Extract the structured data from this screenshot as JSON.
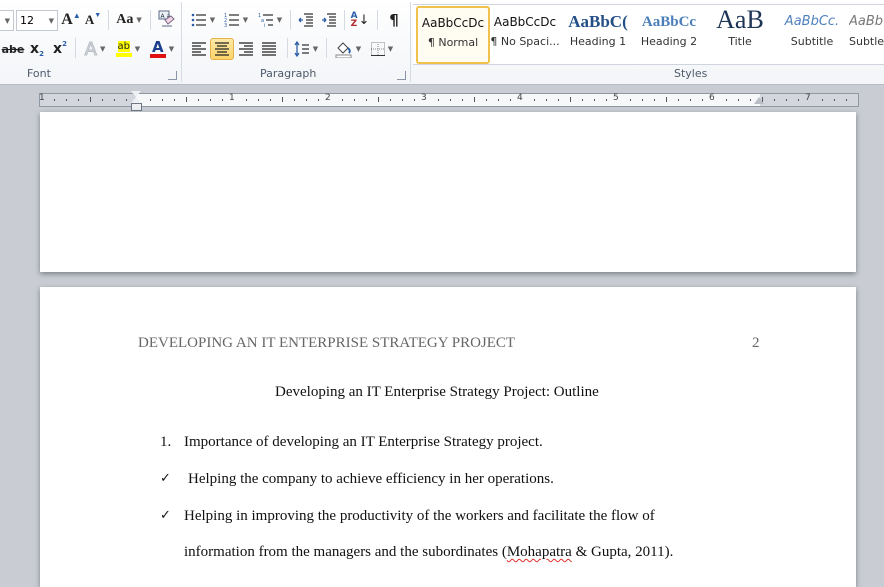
{
  "ribbon": {
    "font_group": {
      "label": "Font",
      "font_size": "12",
      "grow_font": "A",
      "shrink_font": "A",
      "change_case": "Aa",
      "strikethrough": "abe",
      "subscript": "x",
      "superscript": "x",
      "text_effects": "A",
      "highlight": "ab",
      "font_color": "A",
      "highlight_color": "#ffff00",
      "font_color_value": "#e01010"
    },
    "paragraph_group": {
      "label": "Paragraph",
      "pilcrow": "¶",
      "sort_a": "A",
      "sort_z": "Z"
    },
    "styles_group": {
      "label": "Styles",
      "items": [
        {
          "preview": "AaBbCcDc",
          "name": "¶ Normal",
          "selected": true
        },
        {
          "preview": "AaBbCcDc",
          "name": "¶ No Spaci..."
        },
        {
          "preview": "AaBbC(",
          "name": "Heading 1"
        },
        {
          "preview": "AaBbCc",
          "name": "Heading 2"
        },
        {
          "preview": "AaB",
          "name": "Title"
        },
        {
          "preview": "AaBbCc.",
          "name": "Subtitle"
        },
        {
          "preview": "AaBb",
          "name": "Subtle"
        }
      ]
    }
  },
  "ruler": {
    "numbers": [
      "1",
      "1",
      "2",
      "3",
      "4",
      "5",
      "6",
      "7"
    ]
  },
  "document": {
    "header": "DEVELOPING AN IT ENTERPRISE STRATEGY PROJECT",
    "page_number": "2",
    "title": "Developing an IT Enterprise Strategy Project: Outline",
    "list_number": "1.",
    "item1": "Importance of developing an IT Enterprise Strategy project.",
    "check_symbol": "✓",
    "bullet1": "Helping the company to achieve efficiency in her operations.",
    "bullet2_line1": "Helping in improving the productivity of the workers and facilitate the flow of",
    "bullet2_line2_pre": "information from the managers and the subordinates (",
    "bullet2_line2_spell": "Mohapatra",
    "bullet2_line2_post": " & Gupta, 2011)."
  }
}
